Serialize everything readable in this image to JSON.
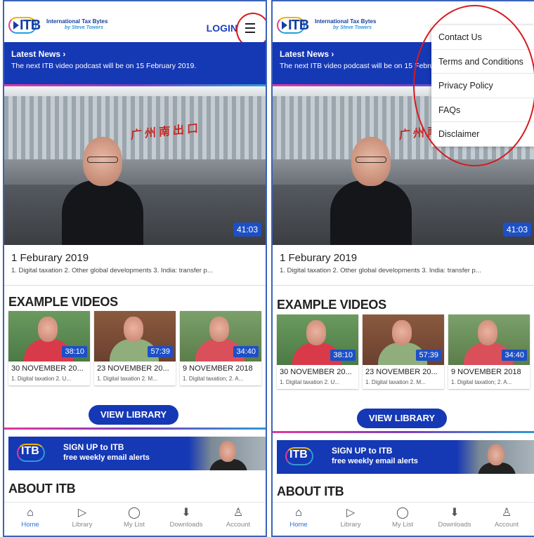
{
  "app": {
    "logo_text": "ITB",
    "logo_line1": "International Tax Bytes",
    "logo_line2": "by Steve Towers",
    "login_label": "LOGIN"
  },
  "news": {
    "heading": "Latest News ›",
    "text": "The next ITB video podcast will be on 15 February 2019."
  },
  "hero": {
    "sign_text": "广州南出口",
    "duration": "41:03",
    "title": "1 Feburary 2019",
    "description": "1. Digital taxation 2. Other global developments 3. India: transfer p..."
  },
  "example_videos": {
    "heading": "EXAMPLE VIDEOS",
    "items": [
      {
        "title": "30 NOVEMBER 20...",
        "description": "1. Digital taxation 2. U...",
        "duration": "38:10",
        "shirt": "#d93a4a",
        "bg": "#4c7a46"
      },
      {
        "title": "23 NOVEMBER 20...",
        "description": "1. Digital taxation 2. M...",
        "duration": "57:39",
        "shirt": "#8fae7c",
        "bg": "#6b4030"
      },
      {
        "title": "9 NOVEMBER 2018",
        "description": "1. Digital taxation; 2. A...",
        "duration": "34:40",
        "shirt": "#d9505a",
        "bg": "#5b7d4a"
      }
    ],
    "view_library_label": "VIEW LIBRARY"
  },
  "signup_banner": {
    "logo_text": "ITB",
    "line1": "SIGN UP to ITB",
    "line2": "free weekly email alerts"
  },
  "about": {
    "heading": "ABOUT ITB"
  },
  "tabs": [
    {
      "label": "Home",
      "icon": "home-icon",
      "glyph": "⌂",
      "active": true
    },
    {
      "label": "Library",
      "icon": "library-icon",
      "glyph": "▷",
      "active": false
    },
    {
      "label": "My List",
      "icon": "my-list-icon",
      "glyph": "◯",
      "active": false
    },
    {
      "label": "Downloads",
      "icon": "downloads-icon",
      "glyph": "⬇",
      "active": false
    },
    {
      "label": "Account",
      "icon": "account-icon",
      "glyph": "♙",
      "active": false
    }
  ],
  "dropdown_menu": {
    "items": [
      "Contact Us",
      "Terms and Conditions",
      "Privacy Policy",
      "FAQs",
      "Disclaimer"
    ]
  },
  "colors": {
    "brand_blue": "#1538b5",
    "accent_blue": "#1d4fc5",
    "highlight_red": "#d8191e"
  }
}
